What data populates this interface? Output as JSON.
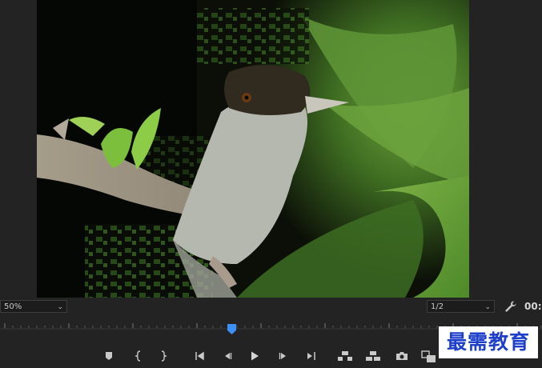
{
  "viewer": {
    "zoom_level": "50%",
    "playback_resolution": "1/2",
    "timecode": "00:"
  },
  "transport": {
    "buttons": [
      {
        "name": "add-marker-button",
        "icon": "marker-icon"
      },
      {
        "name": "mark-in-button",
        "icon": "mark-in-icon"
      },
      {
        "name": "mark-out-button",
        "icon": "mark-out-icon"
      },
      {
        "name": "go-to-in-button",
        "icon": "go-to-in-icon"
      },
      {
        "name": "step-back-button",
        "icon": "step-back-icon"
      },
      {
        "name": "play-button",
        "icon": "play-icon"
      },
      {
        "name": "step-forward-button",
        "icon": "step-forward-icon"
      },
      {
        "name": "go-to-out-button",
        "icon": "go-to-out-icon"
      },
      {
        "name": "lift-button",
        "icon": "lift-icon"
      },
      {
        "name": "extract-button",
        "icon": "extract-icon"
      },
      {
        "name": "export-frame-button",
        "icon": "camera-icon"
      },
      {
        "name": "comparison-view-button",
        "icon": "comparison-view-icon"
      }
    ]
  },
  "watermark": {
    "text": "最需教育"
  },
  "colors": {
    "panel_bg": "#232323",
    "playhead": "#3b8ff5",
    "watermark_text": "#1d3fc9"
  }
}
